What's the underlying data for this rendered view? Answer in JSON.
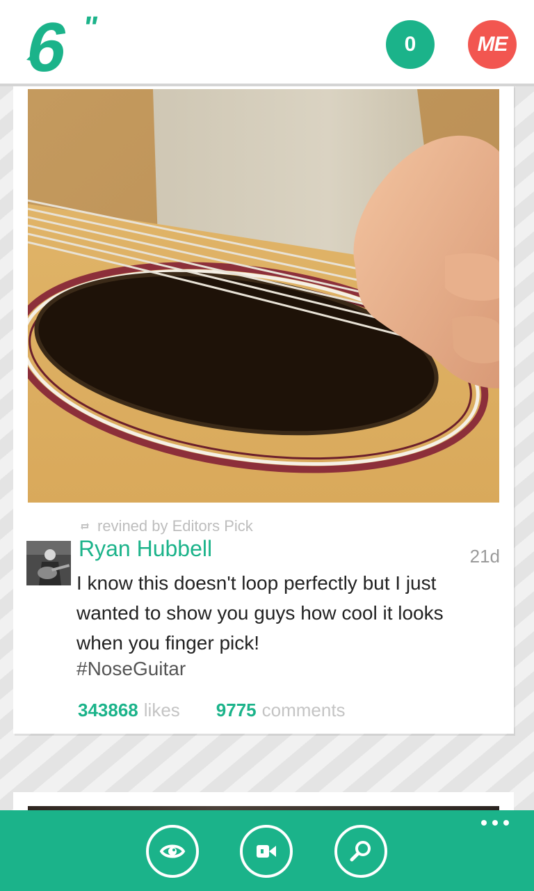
{
  "header": {
    "logo_text": "6\"",
    "notification_count": "0",
    "me_label": "ME"
  },
  "colors": {
    "accent": "#1bb38a",
    "me_badge": "#f25650"
  },
  "post": {
    "revined_by": "revined by Editors Pick",
    "author": "Ryan Hubbell",
    "age": "21d",
    "caption": "I know this doesn't loop perfectly but I just wanted to show you guys how cool it looks when you finger pick!",
    "hashtag": "#NoseGuitar",
    "likes_count": "343868",
    "likes_label": "likes",
    "comments_count": "9775",
    "comments_label": "comments"
  },
  "appbar": {
    "buttons": [
      {
        "icon": "eye-icon"
      },
      {
        "icon": "video-camera-icon"
      },
      {
        "icon": "search-icon"
      }
    ],
    "more_icon": "more-icon"
  }
}
